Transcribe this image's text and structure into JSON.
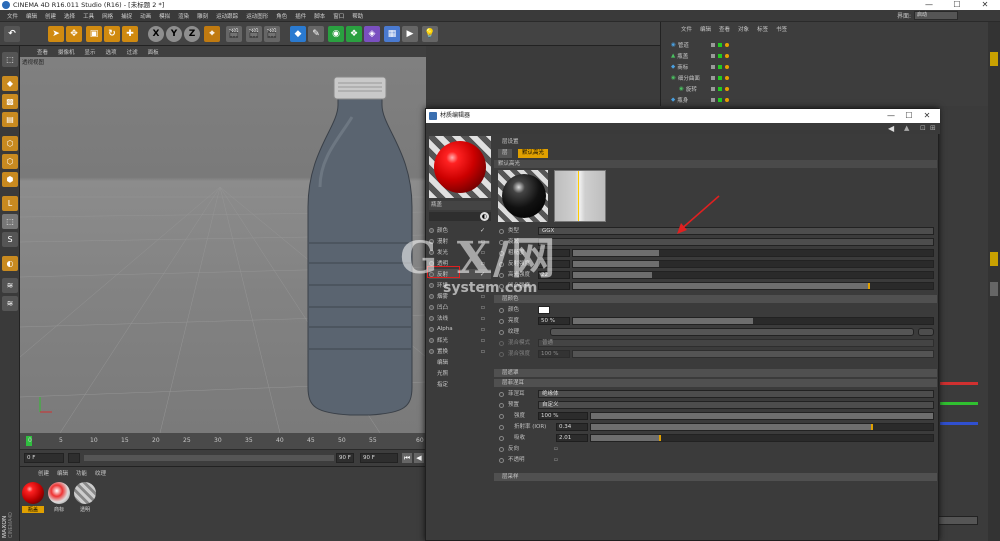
{
  "window": {
    "title": "CINEMA 4D R16.011 Studio (R16) - [未标题 2 *]",
    "min": "—",
    "max": "☐",
    "close": "✕"
  },
  "menu": [
    "文件",
    "编辑",
    "创建",
    "选择",
    "工具",
    "网格",
    "捕捉",
    "动画",
    "模拟",
    "渲染",
    "雕刻",
    "运动跟踪",
    "运动图形",
    "角色",
    "插件",
    "脚本",
    "窗口",
    "帮助"
  ],
  "interface": {
    "label": "界面:",
    "value": "启动"
  },
  "viewport": {
    "menu": [
      "查看",
      "摄像机",
      "显示",
      "选项",
      "过滤",
      "面板"
    ],
    "label": "透视视图"
  },
  "timeline": {
    "ticks": [
      "0",
      "5",
      "10",
      "15",
      "20",
      "25",
      "30",
      "35",
      "40",
      "45",
      "50",
      "55",
      "60"
    ]
  },
  "playback": {
    "start": "0 F",
    "current": "0 F",
    "end": "90 F",
    "end2": "90 F"
  },
  "material_manager": {
    "menu": [
      "创建",
      "编辑",
      "功能",
      "纹理"
    ],
    "items": [
      {
        "name": "瓶盖",
        "color": "#e01010"
      },
      {
        "name": "商标",
        "color": "#e8e8e8"
      },
      {
        "name": "透明",
        "color": "#bfbfbf"
      }
    ]
  },
  "object_manager": {
    "menu": [
      "文件",
      "编辑",
      "查看",
      "对象",
      "标签",
      "书签"
    ],
    "objects": [
      "管道",
      "瓶盖",
      "商标",
      "细分曲面",
      "旋转",
      "瓶身"
    ]
  },
  "material_editor": {
    "title": "材质编辑器",
    "material_name": "瓶盖",
    "channels": [
      {
        "name": "颜色",
        "checked": true
      },
      {
        "name": "漫射",
        "checked": false
      },
      {
        "name": "发光",
        "checked": false
      },
      {
        "name": "透明",
        "checked": false
      },
      {
        "name": "反射",
        "checked": true
      },
      {
        "name": "环境",
        "checked": false
      },
      {
        "name": "烟雾",
        "checked": false
      },
      {
        "name": "凹凸",
        "checked": false
      },
      {
        "name": "法线",
        "checked": false
      },
      {
        "name": "Alpha",
        "checked": false
      },
      {
        "name": "辉光",
        "checked": false
      },
      {
        "name": "置换",
        "checked": false
      }
    ],
    "extras": [
      "编辑",
      "光照",
      "指定"
    ],
    "reflect": {
      "layer_header": "层设置",
      "layer_tab": "层",
      "default_tab": "默认高光",
      "default_label": "默认高光",
      "type_label": "类型",
      "type_value": "GGX",
      "attenuation_label": "衰减",
      "rough_label": "粗糙度",
      "refl_strength_label": "反射强度",
      "spec_strength_label": "高光强度",
      "spec_strength_value": "22",
      "bump_label": "凹凸强度",
      "layer_color_header": "层颜色",
      "color_label": "颜色",
      "brightness_label": "亮度",
      "brightness_value": "50 %",
      "texture_label": "纹理",
      "mix_mode_label": "混合模式",
      "mix_mode_value": "普通",
      "mix_strength_label": "混合强度",
      "mix_strength_value": "100 %",
      "layer_mask_header": "层遮罩",
      "layer_fresnel_header": "层菲涅耳",
      "fresnel_label": "菲涅耳",
      "fresnel_value": "绝缘体",
      "preset_label": "预置",
      "preset_value": "自定义",
      "strength_label": "强度",
      "strength_value": "100 %",
      "ior_label": "折射率 (IOR)",
      "ior_value": "0.34",
      "absorb_label": "吸收",
      "absorb_value": "2.01",
      "invert_label": "反向",
      "opaque_label": "不透明",
      "sampling_header": "层采样"
    }
  },
  "watermark": {
    "main": "G X/网",
    "sub": "system.com"
  }
}
